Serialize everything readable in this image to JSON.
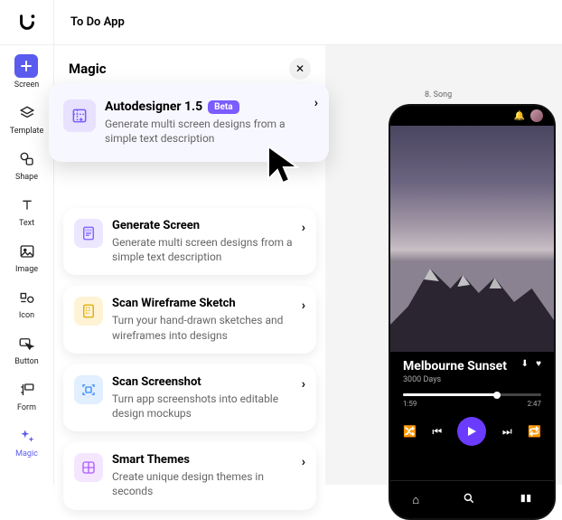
{
  "project": {
    "title": "To Do App"
  },
  "sidebar": {
    "items": [
      {
        "label": "Screen"
      },
      {
        "label": "Template"
      },
      {
        "label": "Shape"
      },
      {
        "label": "Text"
      },
      {
        "label": "Image"
      },
      {
        "label": "Icon"
      },
      {
        "label": "Button"
      },
      {
        "label": "Form"
      },
      {
        "label": "Magic"
      }
    ]
  },
  "panel": {
    "title": "Magic",
    "cards": [
      {
        "title": "Autodesigner 1.5",
        "beta": "Beta",
        "desc": "Generate multi screen designs from a simple text description"
      },
      {
        "title": "Generate Screen",
        "desc": "Generate multi screen designs from a simple text description"
      },
      {
        "title": "Scan Wireframe Sketch",
        "desc": "Turn your hand-drawn sketches and wireframes into designs"
      },
      {
        "title": "Scan Screenshot",
        "desc": "Turn app screenshots into editable design mockups"
      },
      {
        "title": "Smart Themes",
        "desc": "Create unique design themes in seconds"
      }
    ]
  },
  "canvas": {
    "label": "8. Song"
  },
  "player": {
    "title": "Melbourne Sunset",
    "artist": "3000 Days",
    "elapsed": "1:59",
    "total": "2:47"
  }
}
